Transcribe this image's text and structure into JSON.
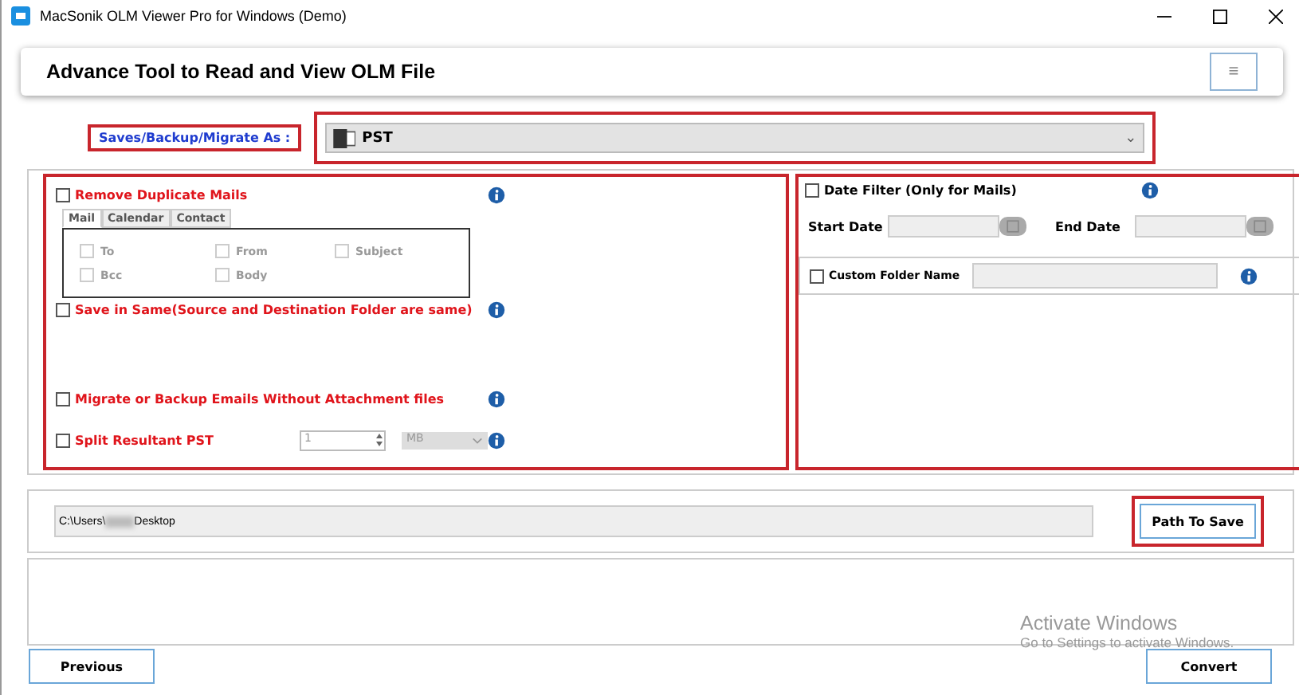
{
  "window": {
    "title": "MacSonik OLM Viewer Pro for Windows (Demo)"
  },
  "header": {
    "title": "Advance Tool to Read and View OLM File",
    "menu_glyph": "≡"
  },
  "save_as": {
    "label": "Saves/Backup/Migrate As :",
    "value": "PST",
    "caret": "⌄"
  },
  "options": [
    {
      "kind": "dedupe",
      "label": "Remove Duplicate Mails",
      "checked": false,
      "tabs": [
        {
          "label": "Mail",
          "selected": true
        },
        {
          "label": "Calendar",
          "selected": false
        },
        {
          "label": "Contact",
          "selected": false
        }
      ],
      "fields": [
        {
          "label": "To",
          "checked": false
        },
        {
          "label": "From",
          "checked": false
        },
        {
          "label": "Subject",
          "checked": false
        },
        {
          "label": "Bcc",
          "checked": false
        },
        {
          "label": "Body",
          "checked": false
        }
      ]
    },
    {
      "kind": "plain",
      "label": "Save in Same(Source and Destination Folder are same)",
      "checked": false
    },
    {
      "kind": "plain",
      "label": "Migrate or Backup Emails Without Attachment files",
      "checked": false
    },
    {
      "kind": "split",
      "label": "Split Resultant PST",
      "checked": false,
      "size": "1",
      "unit": "MB"
    }
  ],
  "date_filter": {
    "label": "Date Filter  (Only for Mails)",
    "checked": false,
    "start_label": "Start Date",
    "end_label": "End Date"
  },
  "custom_folder": {
    "label": "Custom Folder Name",
    "checked": false
  },
  "path": {
    "prefix": "C:\\Users\\",
    "suffix": "Desktop",
    "button": "Path To Save"
  },
  "buttons": {
    "previous": "Previous",
    "convert": "Convert"
  },
  "watermark": {
    "title": "Activate Windows",
    "subtitle": "Go to Settings to activate Windows."
  }
}
